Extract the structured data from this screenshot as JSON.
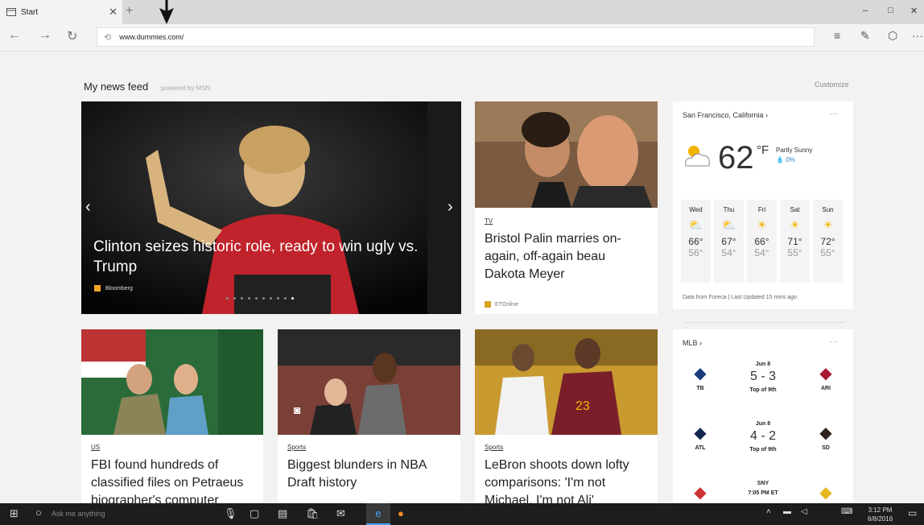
{
  "browser": {
    "tab_title": "Start",
    "new_tab": "+",
    "url": "www.dummies.com/",
    "win": {
      "min": "–",
      "max": "□",
      "close": "✕"
    }
  },
  "page": {
    "feed_title": "My news feed",
    "powered_by": "powered by MSN",
    "customize": "Customize"
  },
  "hero": {
    "headline": "Clinton seizes historic role, ready to win ugly vs. Trump",
    "source": "Bloomberg",
    "slides": 10,
    "active_slide": 10
  },
  "stories": [
    {
      "kicker": "TV",
      "headline": "Bristol Palin marries on-again, off-again beau Dakota Meyer",
      "source": "ETOnline"
    },
    {
      "kicker": "US",
      "headline": "FBI found hundreds of classified files on Petraeus biographer's computer",
      "source": ""
    },
    {
      "kicker": "Sports",
      "headline": "Biggest blunders in NBA Draft history",
      "source": ""
    },
    {
      "kicker": "Sports",
      "headline": "LeBron shoots down lofty comparisons: 'I'm not Michael, I'm not Ali'",
      "source": ""
    }
  ],
  "weather": {
    "location": "San Francisco, California",
    "more": "···",
    "temp": "62",
    "unit": "°F",
    "condition": "Partly Sunny",
    "precip": "0%",
    "forecast": [
      {
        "day": "Wed",
        "hi": "66°",
        "lo": "56°",
        "icon": "partly-cloudy-icon"
      },
      {
        "day": "Thu",
        "hi": "67°",
        "lo": "54°",
        "icon": "partly-cloudy-icon"
      },
      {
        "day": "Fri",
        "hi": "66°",
        "lo": "54°",
        "icon": "sun-icon"
      },
      {
        "day": "Sat",
        "hi": "71°",
        "lo": "55°",
        "icon": "sun-icon"
      },
      {
        "day": "Sun",
        "hi": "72°",
        "lo": "55°",
        "icon": "sun-icon"
      }
    ],
    "footer": "Data from Foreca | Last Updated 15 mins ago"
  },
  "mlb": {
    "title": "MLB",
    "more": "···",
    "games": [
      {
        "date": "Jun 8",
        "score": "5 - 3",
        "status": "Top of 9th",
        "away": "TB",
        "home": "ARI"
      },
      {
        "date": "Jun 8",
        "score": "4 - 2",
        "status": "Top of 9th",
        "away": "ATL",
        "home": "SD"
      },
      {
        "date": "SNY",
        "score": "",
        "status": "7:05 PM ET",
        "away": "",
        "home": ""
      }
    ]
  },
  "taskbar": {
    "search": "Ask me anything",
    "time": "3:12 PM",
    "date": "6/8/2016"
  },
  "colors": {
    "bing_orange": "#f5a623",
    "edge_blue": "#1e78d7",
    "accent_blue": "#3b82c4"
  }
}
